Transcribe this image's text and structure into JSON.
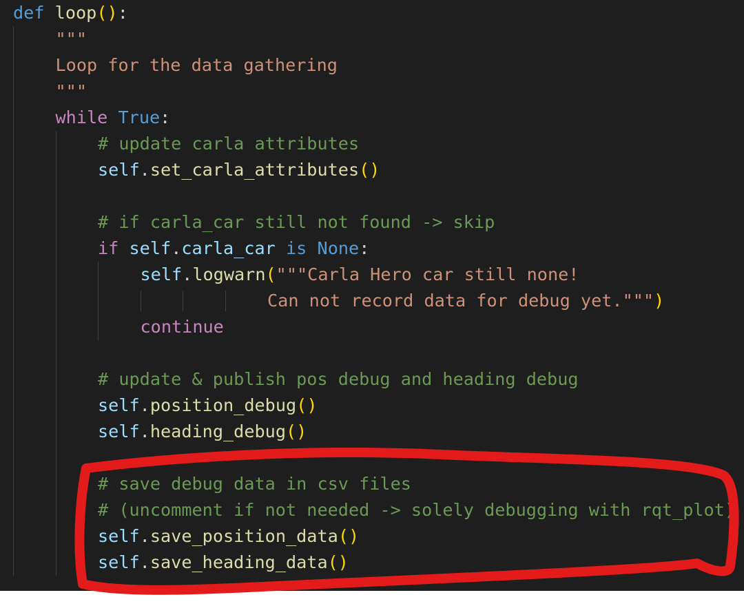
{
  "lines": [
    {
      "id": "def-loop",
      "indent": 0,
      "tokens": [
        {
          "t": "def",
          "c": "kw-blue"
        },
        {
          "t": " ",
          "c": "pl"
        },
        {
          "t": "loop",
          "c": "fn"
        },
        {
          "t": "():",
          "c": "mix_paren_colon"
        }
      ]
    },
    {
      "id": "docstring-open",
      "indent": 1,
      "tokens": [
        {
          "t": "\"\"\"",
          "c": "str"
        }
      ]
    },
    {
      "id": "docstring-text",
      "indent": 1,
      "tokens": [
        {
          "t": "Loop for the data gathering",
          "c": "str"
        }
      ]
    },
    {
      "id": "docstring-close",
      "indent": 1,
      "tokens": [
        {
          "t": "\"\"\"",
          "c": "str"
        }
      ]
    },
    {
      "id": "while-true",
      "indent": 1,
      "tokens": [
        {
          "t": "while",
          "c": "kw-purple"
        },
        {
          "t": " ",
          "c": "pl"
        },
        {
          "t": "True",
          "c": "kw-blue"
        },
        {
          "t": ":",
          "c": "pl"
        }
      ]
    },
    {
      "id": "comment-update-carla",
      "indent": 2,
      "tokens": [
        {
          "t": "# update carla attributes",
          "c": "cmt"
        }
      ]
    },
    {
      "id": "call-set-carla",
      "indent": 2,
      "tokens": [
        {
          "t": "self",
          "c": "var"
        },
        {
          "t": ".",
          "c": "pl"
        },
        {
          "t": "set_carla_attributes",
          "c": "fn"
        },
        {
          "t": "()",
          "c": "br"
        }
      ]
    },
    {
      "id": "blank-1",
      "indent": 2,
      "tokens": []
    },
    {
      "id": "comment-if-not-found",
      "indent": 2,
      "tokens": [
        {
          "t": "# if carla_car still not found -> skip",
          "c": "cmt"
        }
      ]
    },
    {
      "id": "if-carla-car-none",
      "indent": 2,
      "tokens": [
        {
          "t": "if",
          "c": "kw-purple"
        },
        {
          "t": " ",
          "c": "pl"
        },
        {
          "t": "self",
          "c": "var"
        },
        {
          "t": ".",
          "c": "pl"
        },
        {
          "t": "carla_car",
          "c": "var"
        },
        {
          "t": " ",
          "c": "pl"
        },
        {
          "t": "is",
          "c": "kw-blue"
        },
        {
          "t": " ",
          "c": "pl"
        },
        {
          "t": "None",
          "c": "kw-blue"
        },
        {
          "t": ":",
          "c": "pl"
        }
      ]
    },
    {
      "id": "call-logwarn",
      "indent": 3,
      "tokens": [
        {
          "t": "self",
          "c": "var"
        },
        {
          "t": ".",
          "c": "pl"
        },
        {
          "t": "logwarn",
          "c": "fn"
        },
        {
          "t": "(",
          "c": "br"
        },
        {
          "t": "\"\"\"Carla Hero car still none!",
          "c": "str"
        }
      ]
    },
    {
      "id": "logwarn-continuation",
      "indent": 6,
      "tokens": [
        {
          "t": "Can not record data for debug yet.\"\"\"",
          "c": "str"
        },
        {
          "t": ")",
          "c": "br"
        }
      ]
    },
    {
      "id": "continue",
      "indent": 3,
      "tokens": [
        {
          "t": "continue",
          "c": "kw-purple"
        }
      ]
    },
    {
      "id": "blank-2",
      "indent": 2,
      "tokens": []
    },
    {
      "id": "comment-update-publish",
      "indent": 2,
      "tokens": [
        {
          "t": "# update & publish pos debug and heading debug",
          "c": "cmt"
        }
      ]
    },
    {
      "id": "call-position-debug",
      "indent": 2,
      "tokens": [
        {
          "t": "self",
          "c": "var"
        },
        {
          "t": ".",
          "c": "pl"
        },
        {
          "t": "position_debug",
          "c": "fn"
        },
        {
          "t": "()",
          "c": "br"
        }
      ]
    },
    {
      "id": "call-heading-debug",
      "indent": 2,
      "tokens": [
        {
          "t": "self",
          "c": "var"
        },
        {
          "t": ".",
          "c": "pl"
        },
        {
          "t": "heading_debug",
          "c": "fn"
        },
        {
          "t": "()",
          "c": "br"
        }
      ]
    },
    {
      "id": "blank-3",
      "indent": 2,
      "tokens": []
    },
    {
      "id": "comment-save-csv",
      "indent": 2,
      "tokens": [
        {
          "t": "# save debug data in csv files",
          "c": "cmt"
        }
      ]
    },
    {
      "id": "comment-uncomment",
      "indent": 2,
      "tokens": [
        {
          "t": "# (uncomment if not needed -> solely debugging with rqt_plot)",
          "c": "cmt"
        }
      ]
    },
    {
      "id": "call-save-position",
      "indent": 2,
      "tokens": [
        {
          "t": "self",
          "c": "var"
        },
        {
          "t": ".",
          "c": "pl"
        },
        {
          "t": "save_position_data",
          "c": "fn"
        },
        {
          "t": "()",
          "c": "br"
        }
      ]
    },
    {
      "id": "call-save-heading",
      "indent": 2,
      "tokens": [
        {
          "t": "self",
          "c": "var"
        },
        {
          "t": ".",
          "c": "pl"
        },
        {
          "t": "save_heading_data",
          "c": "fn"
        },
        {
          "t": "()",
          "c": "br"
        }
      ]
    }
  ],
  "colors": {
    "background": "#1e1e1e",
    "keyword_blue": "#569cd6",
    "keyword_purple": "#c586c0",
    "function": "#dcdcaa",
    "variable": "#9cdcfe",
    "string": "#ce9178",
    "comment": "#6a9955",
    "bracket": "#ffd700",
    "annotation_red": "#e31b1b"
  }
}
